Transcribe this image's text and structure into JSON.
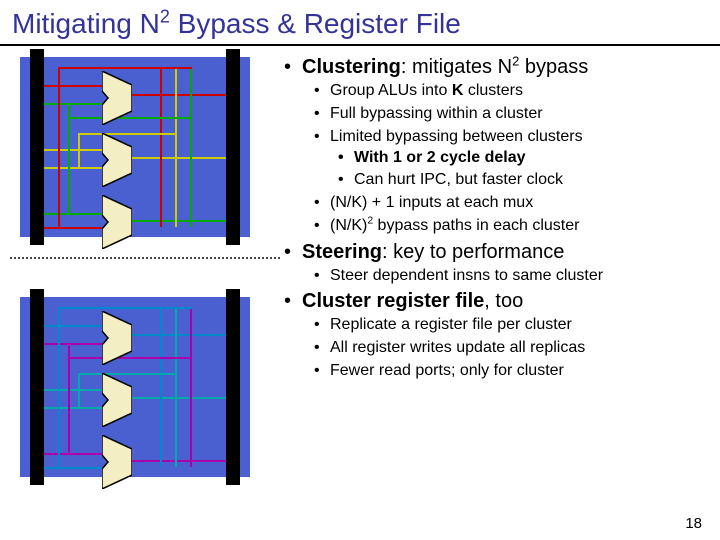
{
  "title_pre": "Mitigating N",
  "title_sup": "2",
  "title_post": " Bypass & Register File",
  "b1_clustering_lead": "Clustering",
  "b1_clustering_rest": ": mitigates N",
  "b1_clustering_sup": "2",
  "b1_clustering_tail": " bypass",
  "b2_group_pre": "Group ALUs into ",
  "b2_group_k": "K",
  "b2_group_post": " clusters",
  "b2_full": "Full bypassing within a cluster",
  "b2_limited": "Limited bypassing between clusters",
  "b3_delay": "With 1 or 2 cycle delay",
  "b3_ipc": "Can hurt IPC, but faster clock",
  "b2_inputs": "(N/K) + 1 inputs at each mux",
  "b2_paths_pre": "(N/K)",
  "b2_paths_sup": "2",
  "b2_paths_post": " bypass paths in each cluster",
  "b1_steering_lead": "Steering",
  "b1_steering_rest": ": key to performance",
  "b2_steer": "Steer dependent insns to same cluster",
  "b1_crf_lead": "Cluster register file",
  "b1_crf_rest": ", too",
  "b2_rep": "Replicate a register file per cluster",
  "b2_writes": "All register writes update all replicas",
  "b2_ports": "Fewer read ports; only for cluster",
  "pagenum": "18"
}
